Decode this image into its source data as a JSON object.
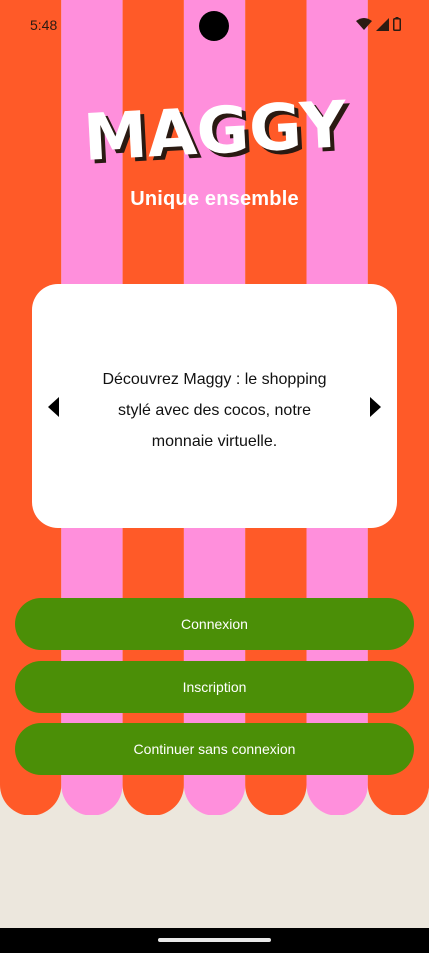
{
  "status_bar": {
    "time": "5:48"
  },
  "app": {
    "logo_text": "MAGGY",
    "tagline": "Unique ensemble"
  },
  "carousel": {
    "slide_text": "Découvrez Maggy : le shopping stylé avec des cocos, notre monnaie virtuelle.",
    "prev_icon": "chevron-left-icon",
    "next_icon": "chevron-right-icon"
  },
  "buttons": {
    "login": "Connexion",
    "signup": "Inscription",
    "guest": "Continuer sans connexion"
  },
  "colors": {
    "stripe_orange": "#ff5a28",
    "stripe_pink": "#ff8fdc",
    "button_green": "#4b8f07",
    "background": "#ece7dd"
  }
}
